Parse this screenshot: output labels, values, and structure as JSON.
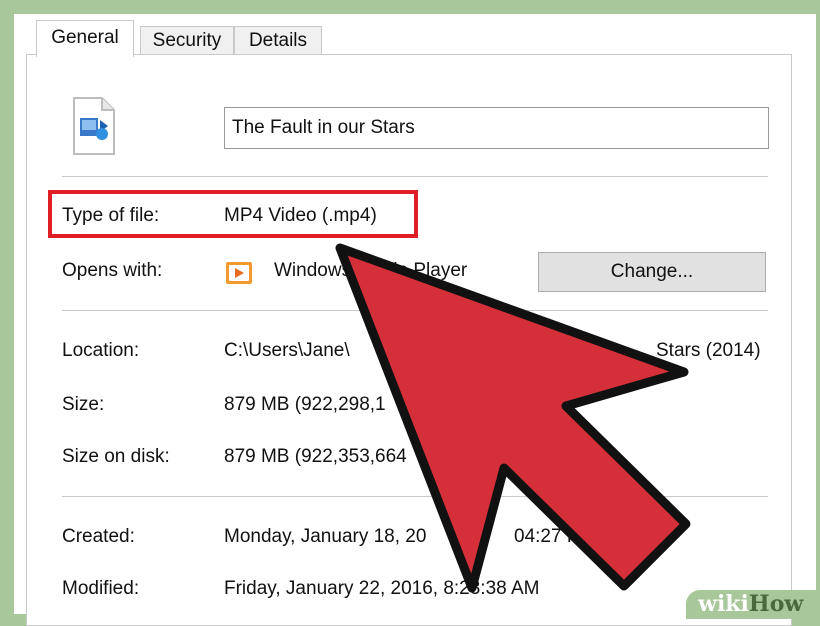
{
  "tabs": [
    {
      "label": "General",
      "active": true
    },
    {
      "label": "Security",
      "active": false
    },
    {
      "label": "Details",
      "active": false
    }
  ],
  "file_name": "The Fault in our Stars",
  "type_of_file": {
    "label": "Type of file:",
    "value": "MP4 Video (.mp4)"
  },
  "opens_with": {
    "label": "Opens with:",
    "value": "Windows Media Player",
    "change_button": "Change..."
  },
  "location": {
    "label": "Location:",
    "value": "C:\\Users\\Jane\\",
    "value_tail": "Stars (2014)"
  },
  "size": {
    "label": "Size:",
    "value": "879 MB (922,298,1"
  },
  "size_on_disk": {
    "label": "Size on disk:",
    "value": "879 MB (922,353,664"
  },
  "created": {
    "label": "Created:",
    "value": "Monday, January 18, 20",
    "value_tail": "04:27 PM"
  },
  "modified": {
    "label": "Modified:",
    "value": "Friday, January 22, 2016, 8:23:38 AM"
  },
  "watermark": {
    "part1": "wiki",
    "part2": "How"
  },
  "colors": {
    "highlight": "#e01e26",
    "arrow_fill": "#d5303a",
    "arrow_stroke": "#111111"
  }
}
